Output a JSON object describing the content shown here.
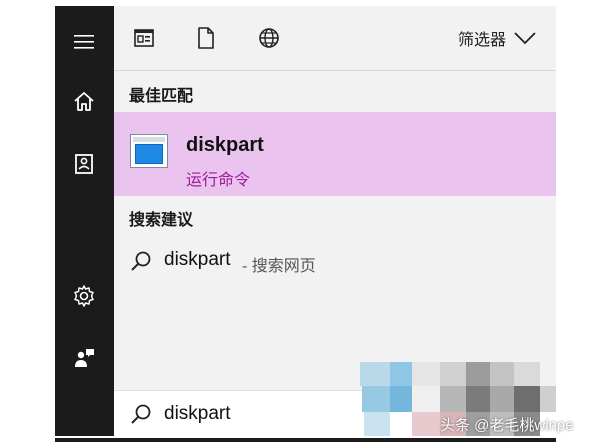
{
  "rail": {
    "items": [
      {
        "icon": "hamburger-menu-icon"
      },
      {
        "icon": "home-icon"
      },
      {
        "icon": "document-folder-icon"
      },
      {
        "icon": "gear-icon"
      },
      {
        "icon": "user-feedback-icon"
      }
    ]
  },
  "toolbar": {
    "icons": [
      "apps-icon",
      "document-icon",
      "web-globe-icon"
    ],
    "filter_label": "筛选器"
  },
  "best_match": {
    "section_title": "最佳匹配",
    "name": "diskpart",
    "subtitle": "运行命令",
    "highlight_color": "#ebc3ef",
    "subtitle_color": "#9b1d9a"
  },
  "suggestions": {
    "section_title": "搜索建议",
    "items": [
      {
        "text": "diskpart",
        "hint": "- 搜索网页"
      }
    ]
  },
  "search": {
    "value": "diskpart"
  },
  "watermark": "头条 @老毛桃winpe"
}
